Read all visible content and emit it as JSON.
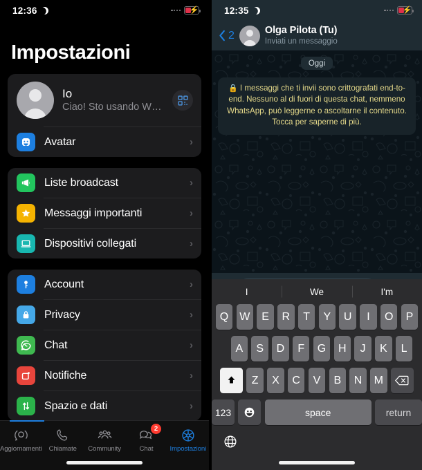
{
  "left": {
    "status": {
      "time": "12:36",
      "moon_icon": "crescent-moon-icon",
      "battery_icon": "battery-low-charging-icon"
    },
    "title": "Impostazioni",
    "profile": {
      "name": "Io",
      "status_text": "Ciao! Sto usando Whats...",
      "qr_icon": "qr-code-icon",
      "avatar_icon": "person-avatar-icon"
    },
    "avatar_row": {
      "label": "Avatar",
      "icon": "avatar-face-icon",
      "chevron": "›"
    },
    "group2": [
      {
        "label": "Liste broadcast",
        "icon": "megaphone-icon",
        "color": "#22c55e",
        "chevron": "›"
      },
      {
        "label": "Messaggi importanti",
        "icon": "star-icon",
        "color": "#f5b301",
        "chevron": "›"
      },
      {
        "label": "Dispositivi collegati",
        "icon": "laptop-icon",
        "color": "#18b7b0",
        "chevron": "›"
      }
    ],
    "group3": [
      {
        "label": "Account",
        "icon": "key-icon",
        "color": "#1d7fe0",
        "chevron": "›"
      },
      {
        "label": "Privacy",
        "icon": "lock-icon",
        "color": "#45a8e8",
        "chevron": "›"
      },
      {
        "label": "Chat",
        "icon": "whatsapp-icon",
        "color": "#3fb950",
        "chevron": "›"
      },
      {
        "label": "Notifiche",
        "icon": "bell-icon",
        "color": "#e8453c",
        "chevron": "›"
      },
      {
        "label": "Spazio e dati",
        "icon": "arrows-updown-icon",
        "color": "#2bb34a",
        "chevron": "›"
      }
    ],
    "tabs": [
      {
        "label": "Aggiornamenti",
        "icon": "status-rings-icon",
        "badge": "",
        "active": false
      },
      {
        "label": "Chiamate",
        "icon": "phone-icon",
        "badge": "",
        "active": false
      },
      {
        "label": "Community",
        "icon": "people-group-icon",
        "badge": "",
        "active": false
      },
      {
        "label": "Chat",
        "icon": "chat-bubbles-icon",
        "badge": "2",
        "active": false
      },
      {
        "label": "Impostazioni",
        "icon": "gear-icon",
        "badge": "",
        "active": true
      }
    ]
  },
  "right": {
    "status": {
      "time": "12:35",
      "moon_icon": "crescent-moon-icon",
      "battery_icon": "battery-low-charging-icon"
    },
    "header": {
      "back_icon": "chevron-left-icon",
      "back_count": "2",
      "avatar_icon": "person-avatar-icon",
      "name": "Olga Pilota (Tu)",
      "subtitle": "Inviati un messaggio"
    },
    "chat": {
      "day_chip": "Oggi",
      "e2e_lock_icon": "lock-emoji",
      "e2e_notice": "I messaggi che ti invii sono crittografati end-to-end. Nessuno al di fuori di questa chat, nemmeno WhatsApp, può leggerne o ascoltarne il contenuto. Tocca per saperne di più."
    },
    "input": {
      "plus_icon": "plus-icon",
      "placeholder": "",
      "sticker_icon": "sticker-icon",
      "camera_icon": "camera-icon",
      "mic_icon": "microphone-icon"
    },
    "keyboard": {
      "suggestions": [
        "I",
        "We",
        "I'm"
      ],
      "row1": [
        "Q",
        "W",
        "E",
        "R",
        "T",
        "Y",
        "U",
        "I",
        "O",
        "P"
      ],
      "row2": [
        "A",
        "S",
        "D",
        "F",
        "G",
        "H",
        "J",
        "K",
        "L"
      ],
      "row3": [
        "Z",
        "X",
        "C",
        "V",
        "B",
        "N",
        "M"
      ],
      "shift_icon": "shift-up-icon",
      "backspace_icon": "backspace-icon",
      "numeric_label": "123",
      "emoji_icon": "smiley-icon",
      "space_label": "space",
      "return_label": "return",
      "globe_icon": "globe-icon"
    }
  },
  "colors": {
    "accent_blue": "#1d7fe0",
    "badge_red": "#ff3b30",
    "e2e_yellow": "#e5d98a",
    "card_bg": "#1c1c1e"
  }
}
